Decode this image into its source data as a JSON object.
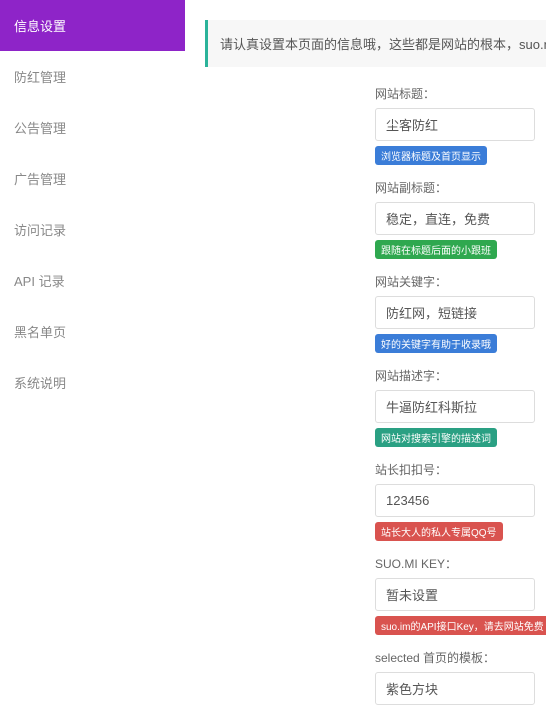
{
  "sidebar": {
    "items": [
      {
        "label": "信息设置",
        "active": true
      },
      {
        "label": "防红管理",
        "active": false
      },
      {
        "label": "公告管理",
        "active": false
      },
      {
        "label": "广告管理",
        "active": false
      },
      {
        "label": "访问记录",
        "active": false
      },
      {
        "label": "API 记录",
        "active": false
      },
      {
        "label": "黑名单页",
        "active": false
      },
      {
        "label": "系统说明",
        "active": false
      }
    ]
  },
  "alert": {
    "text": "请认真设置本页面的信息哦，这些都是网站的根本，suo.mi的key直接去"
  },
  "fields": [
    {
      "label": "网站标题：",
      "value": "尘客防红",
      "hint": "浏览器标题及首页显示",
      "hintColor": "b-blue"
    },
    {
      "label": "网站副标题：",
      "value": "稳定，直连，免费",
      "hint": "跟随在标题后面的小跟班",
      "hintColor": "b-green"
    },
    {
      "label": "网站关键字：",
      "value": "防红网，短链接",
      "hint": "好的关键字有助于收录哦",
      "hintColor": "b-blue"
    },
    {
      "label": "网站描述字：",
      "value": "牛逼防红科斯拉",
      "hint": "网站对搜索引擎的描述词",
      "hintColor": "b-teal"
    },
    {
      "label": "站长扣扣号：",
      "value": "123456",
      "hint": "站长大人的私人专属QQ号",
      "hintColor": "b-red"
    },
    {
      "label": "SUO.MI KEY：",
      "value": "暂未设置",
      "hint": "suo.im的API接口Key，请去网站免费",
      "hintColor": "b-red"
    },
    {
      "label": "selected 首页的模板：",
      "value": "紫色方块",
      "hint": "",
      "hintColor": ""
    }
  ]
}
